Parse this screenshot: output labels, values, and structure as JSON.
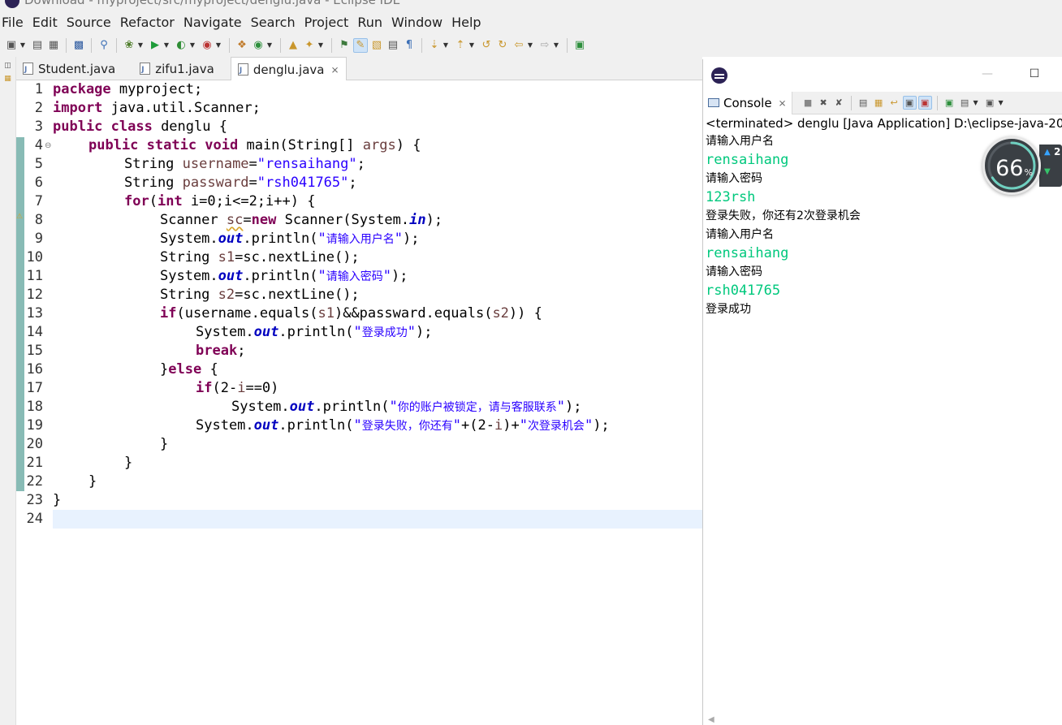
{
  "window": {
    "title": "Download - myproject/src/myproject/denglu.java - Eclipse IDE"
  },
  "menubar": {
    "items": [
      "File",
      "Edit",
      "Source",
      "Refactor",
      "Navigate",
      "Search",
      "Project",
      "Run",
      "Window",
      "Help"
    ]
  },
  "toolbar": {
    "icons": [
      "new-icon",
      "save-icon",
      "save-all-icon",
      "terminal-icon",
      "search-type-icon",
      "debug-icon",
      "run-icon",
      "coverage-icon",
      "external-tools-icon",
      "new-java-project-icon",
      "new-class-icon",
      "open-type-icon",
      "search-icon",
      "toggle-mark-occurrences-icon",
      "highlight-icon",
      "block-selection-icon",
      "show-whitespace-icon",
      "pilcrow-icon",
      "next-annotation-icon",
      "previous-annotation-icon",
      "last-edit-icon",
      "back-icon",
      "forward-icon",
      "open-perspective-icon"
    ]
  },
  "editor": {
    "tabs": [
      {
        "label": "Student.java",
        "selected": false
      },
      {
        "label": "zifu1.java",
        "selected": false
      },
      {
        "label": "denglu.java",
        "selected": true
      }
    ],
    "lines": [
      "1",
      "2",
      "3",
      "4",
      "5",
      "6",
      "7",
      "8",
      "9",
      "10",
      "11",
      "12",
      "13",
      "14",
      "15",
      "16",
      "17",
      "18",
      "19",
      "20",
      "21",
      "22",
      "23",
      "24"
    ],
    "code": {
      "l1_kw": "package",
      "l1_rest": " myproject;",
      "l2_kw": "import",
      "l2_rest": " java.util.Scanner;",
      "l3_kw": "public class",
      "l3_rest": " denglu {",
      "l4_kw": "public static void",
      "l4_a": " main(String[] ",
      "l4_args": "args",
      "l4_b": ") {",
      "l5_a": "String ",
      "l5_var": "username",
      "l5_b": "=",
      "l5_str": "\"rensaihang\"",
      "l5_c": ";",
      "l6_a": "String ",
      "l6_var": "passward",
      "l6_b": "=",
      "l6_str": "\"rsh041765\"",
      "l6_c": ";",
      "l7_for": "for",
      "l7_a": "(",
      "l7_int": "int",
      "l7_b": " i=0;i<=2;i++) {",
      "l8_a": "Scanner ",
      "l8_var": "sc",
      "l8_b": "=",
      "l8_new": "new",
      "l8_c": " Scanner(System.",
      "l8_in": "in",
      "l8_d": ");",
      "l9_a": "System.",
      "l9_out": "out",
      "l9_b": ".println(",
      "l9_q1": "\"",
      "l9_cjk": "请输入用户名",
      "l9_q2": "\"",
      "l9_c": ");",
      "l10_a": "String ",
      "l10_var": "s1",
      "l10_b": "=sc.nextLine();",
      "l11_a": "System.",
      "l11_out": "out",
      "l11_b": ".println(",
      "l11_q1": "\"",
      "l11_cjk": "请输入密码",
      "l11_q2": "\"",
      "l11_c": ");",
      "l12_a": "String ",
      "l12_var": "s2",
      "l12_b": "=sc.nextLine();",
      "l13_if": "if",
      "l13_a": "(username.equals(",
      "l13_s1": "s1",
      "l13_b": ")&&passward.equals(",
      "l13_s2": "s2",
      "l13_c": ")) {",
      "l14_a": "System.",
      "l14_out": "out",
      "l14_b": ".println(",
      "l14_q1": "\"",
      "l14_cjk": "登录成功",
      "l14_q2": "\"",
      "l14_c": ");",
      "l15_kw": "break",
      "l15_c": ";",
      "l16_a": "}",
      "l16_kw": "else",
      "l16_b": " {",
      "l17_if": "if",
      "l17_a": "(2-",
      "l17_i": "i",
      "l17_b": "==0)",
      "l18_a": "System.",
      "l18_out": "out",
      "l18_b": ".println(",
      "l18_q1": "\"",
      "l18_cjk": "你的账户被锁定，请与客服联系",
      "l18_q2": "\"",
      "l18_c": ");",
      "l19_a": "System.",
      "l19_out": "out",
      "l19_b": ".println(",
      "l19_q1": "\"",
      "l19_cjk1": "登录失败，你还有",
      "l19_q2": "\"",
      "l19_c": "+(2-",
      "l19_i": "i",
      "l19_d": ")+",
      "l19_q3": "\"",
      "l19_cjk2": "次登录机会",
      "l19_q4": "\"",
      "l19_e": ");",
      "l20": "}",
      "l21": "}",
      "l22": "}",
      "l23": "}",
      "l24": ""
    }
  },
  "console": {
    "tab_label": "Console",
    "status": "<terminated> denglu [Java Application] D:\\eclipse-java-2021",
    "output": [
      {
        "text": "请输入用户名",
        "kind": "stdout"
      },
      {
        "text": "rensaihang",
        "kind": "stdin"
      },
      {
        "text": "请输入密码",
        "kind": "stdout"
      },
      {
        "text": "123rsh",
        "kind": "stdin"
      },
      {
        "text": "登录失败，你还有2次登录机会",
        "kind": "stdout"
      },
      {
        "text": "请输入用户名",
        "kind": "stdout"
      },
      {
        "text": "rensaihang",
        "kind": "stdin"
      },
      {
        "text": "请输入密码",
        "kind": "stdout"
      },
      {
        "text": "rsh041765",
        "kind": "stdin"
      },
      {
        "text": "登录成功",
        "kind": "stdout"
      }
    ],
    "colors": {
      "stdin": "#00c87d",
      "stdout": "#000000"
    }
  },
  "perf_widget": {
    "value": "66",
    "unit": "%",
    "fraction": 0.66,
    "side_value": "2"
  },
  "colors": {
    "keyword": "#7f0055",
    "string": "#2a00ff",
    "field": "#0000c0",
    "change_ruler": "#88bbb5",
    "current_line": "#e8f2fe"
  }
}
